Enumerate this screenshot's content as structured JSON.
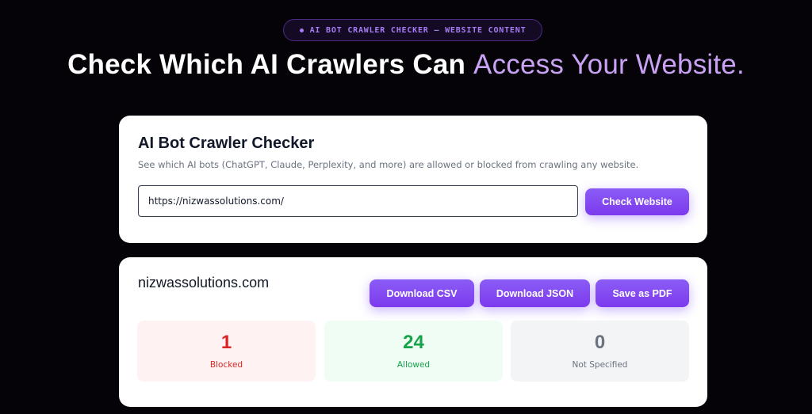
{
  "hero": {
    "badge": "AI BOT CRAWLER CHECKER — WEBSITE CONTENT",
    "headline_main": "Check Which AI Crawlers Can ",
    "headline_accent": "Access Your Website."
  },
  "checker": {
    "title": "AI Bot Crawler Checker",
    "subtitle": "See which AI bots (ChatGPT, Claude, Perplexity, and more) are allowed or blocked from crawling any website.",
    "url_value": "https://nizwassolutions.com/",
    "button": "Check Website"
  },
  "results": {
    "domain": "nizwassolutions.com",
    "buttons": {
      "csv": "Download CSV",
      "json": "Download JSON",
      "pdf": "Save as PDF"
    },
    "stats": {
      "blocked": {
        "value": "1",
        "label": "Blocked"
      },
      "allowed": {
        "value": "24",
        "label": "Allowed"
      },
      "not_specified": {
        "value": "0",
        "label": "Not Specified"
      }
    }
  },
  "colors": {
    "accent": "#8b5cf6",
    "blocked": "#dc2626",
    "allowed": "#16a34a",
    "neutral": "#6b7280"
  }
}
